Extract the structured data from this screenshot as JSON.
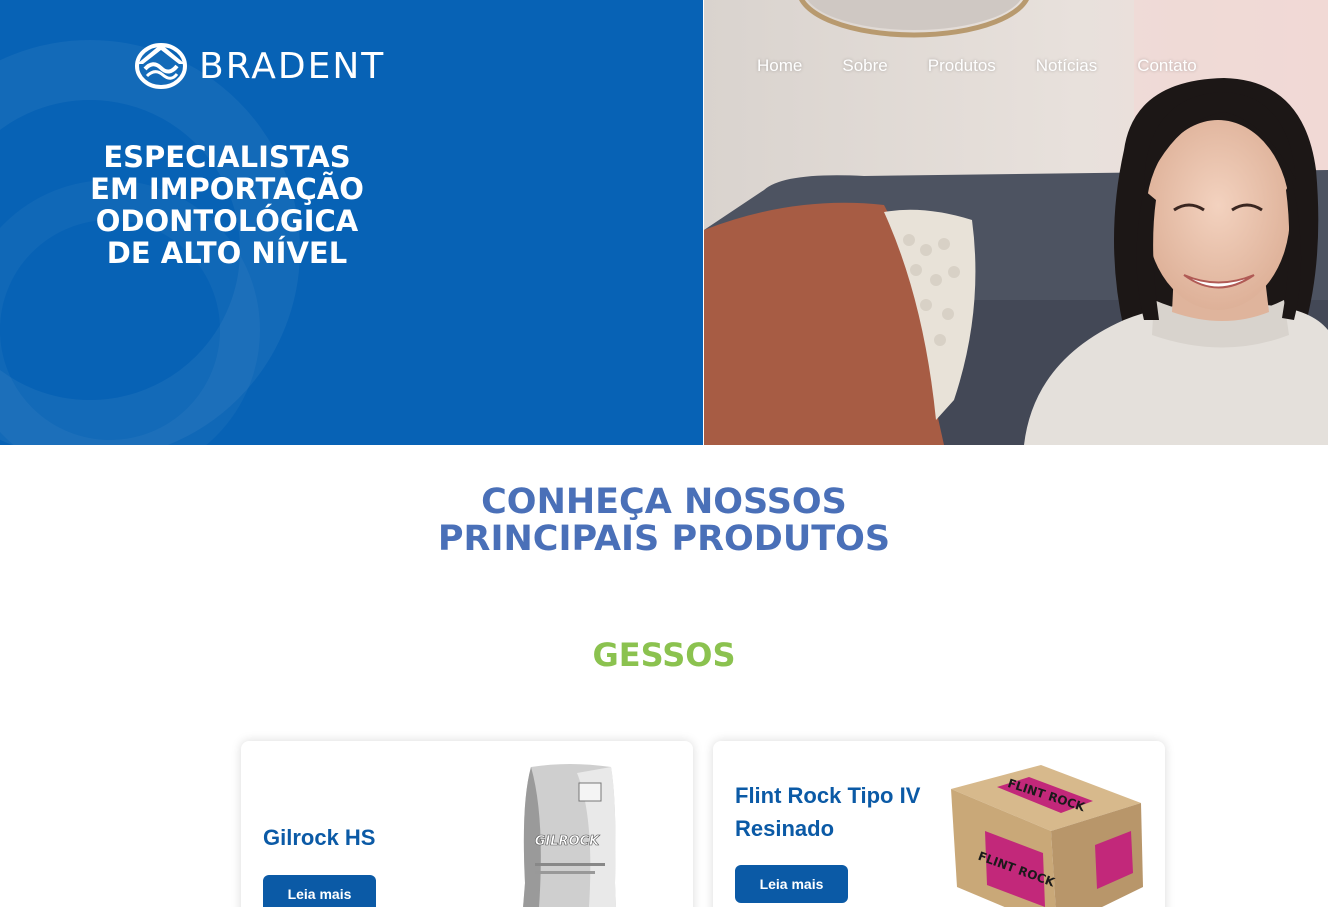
{
  "brand": {
    "name": "BRADENT",
    "color": "#0762b5"
  },
  "nav": {
    "items": [
      {
        "label": "Home"
      },
      {
        "label": "Sobre"
      },
      {
        "label": "Produtos"
      },
      {
        "label": "Notícias"
      },
      {
        "label": "Contato"
      }
    ]
  },
  "hero": {
    "title_lines": [
      "ESPECIALISTAS",
      "EM IMPORTAÇÃO",
      "ODONTOLÓGICA",
      "DE ALTO NÍVEL"
    ]
  },
  "section": {
    "title_lines": [
      "CONHEÇA NOSSOS",
      "PRINCIPAIS PRODUTOS"
    ],
    "category": "GESSOS",
    "title_color": "#4a70b8",
    "category_color": "#8bc24f"
  },
  "products": [
    {
      "name": "Gilrock HS",
      "button": "Leia mais",
      "package_text": "GILROCK"
    },
    {
      "name": "Flint Rock Tipo IV Resinado",
      "button": "Leia mais",
      "package_text": "FLINT ROCK"
    }
  ]
}
